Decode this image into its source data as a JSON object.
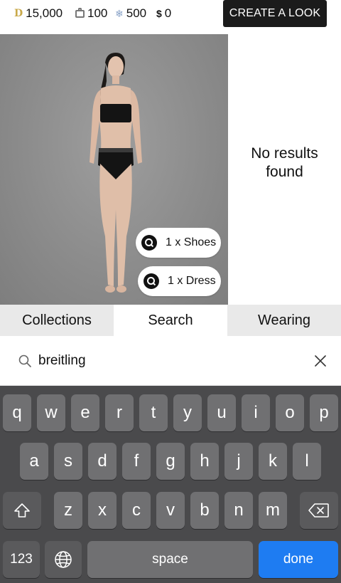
{
  "currencies": [
    {
      "icon": "diamond-currency-icon",
      "value": "15,000"
    },
    {
      "icon": "box-currency-icon",
      "value": "100"
    },
    {
      "icon": "gem-currency-icon",
      "value": "500"
    },
    {
      "icon": "dollar-currency-icon",
      "value": "0"
    }
  ],
  "header": {
    "create_look_label": "CREATE A LOOK"
  },
  "results": {
    "empty_text": "No results found"
  },
  "worn_items": [
    {
      "label": "1 x Shoes"
    },
    {
      "label": "1 x Dress"
    }
  ],
  "tabs": [
    {
      "label": "Collections",
      "active": false
    },
    {
      "label": "Search",
      "active": true
    },
    {
      "label": "Wearing",
      "active": false
    }
  ],
  "search": {
    "value": "breitling"
  },
  "keyboard": {
    "row1": [
      "q",
      "w",
      "e",
      "r",
      "t",
      "y",
      "u",
      "i",
      "o",
      "p"
    ],
    "row2": [
      "a",
      "s",
      "d",
      "f",
      "g",
      "h",
      "j",
      "k",
      "l"
    ],
    "row3": [
      "z",
      "x",
      "c",
      "v",
      "b",
      "n",
      "m"
    ],
    "numbers_label": "123",
    "space_label": "space",
    "done_label": "done"
  },
  "colors": {
    "done_key": "#1e7cf2",
    "create_button": "#1b1b1b"
  }
}
